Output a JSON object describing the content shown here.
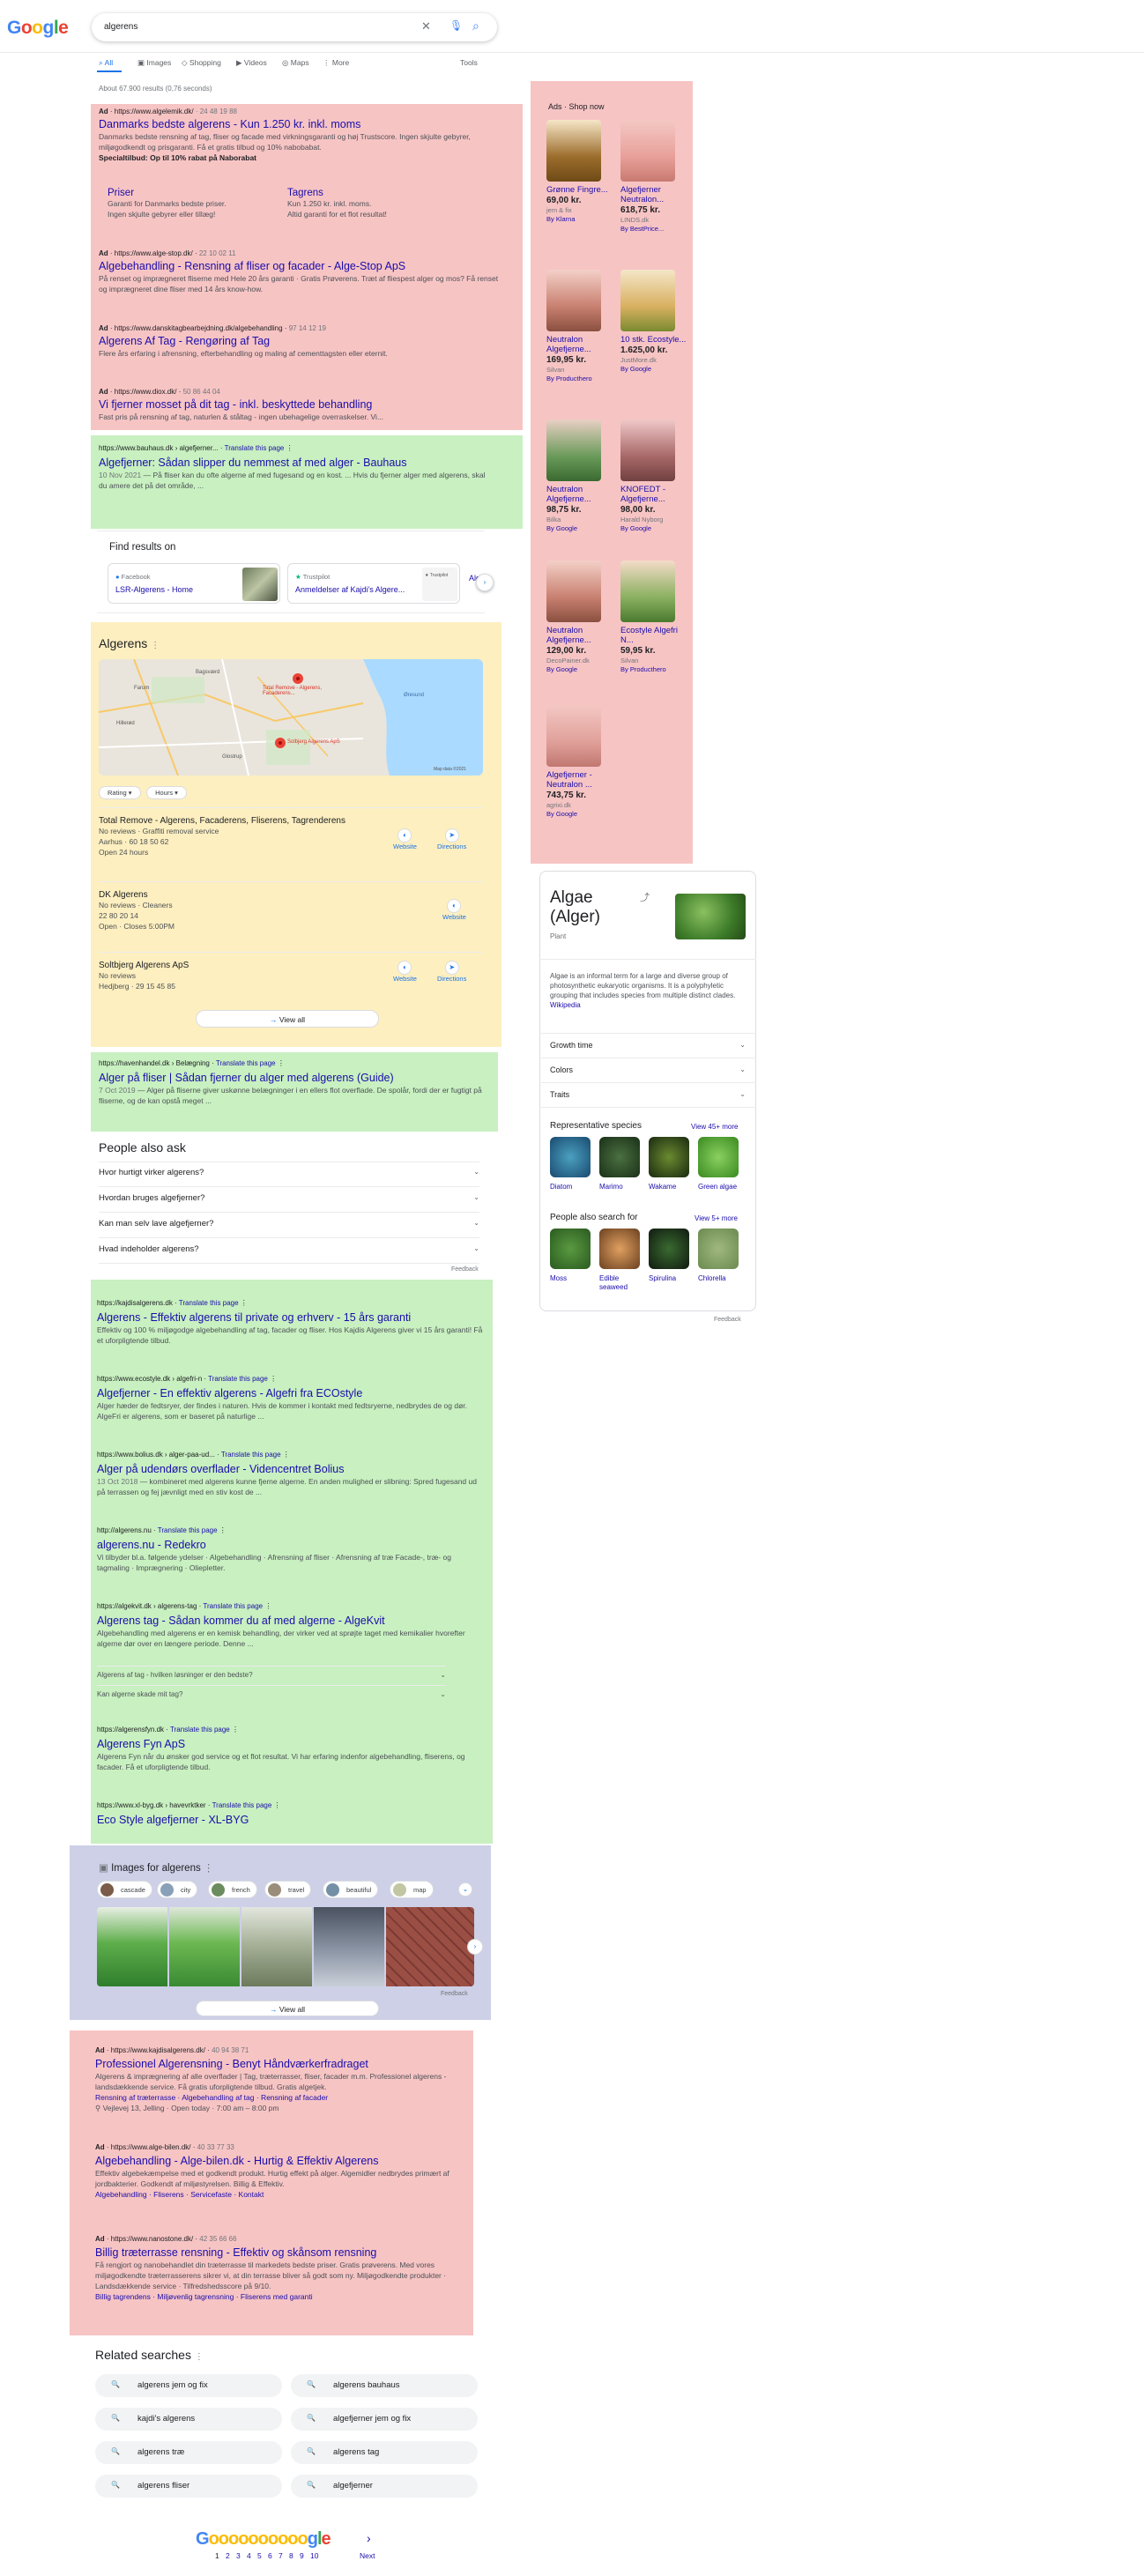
{
  "header": {
    "logo": "Google",
    "query": "algerens"
  },
  "tabs": [
    "All",
    "Images",
    "Shopping",
    "Videos",
    "Maps",
    "More"
  ],
  "tools": "Tools",
  "stats": "About 67.900 results (0,76 seconds)",
  "top_ads": [
    {
      "label": "Ad",
      "url": "https://www.algelemik.dk/",
      "phone": "24 48 19 88",
      "title": "Danmarks bedste algerens - Kun 1.250 kr. inkl. moms",
      "desc": "Danmarks bedste rensning af tag, fliser og facade med virkningsgaranti og høj Trustscore. Ingen skjulte gebyrer, miljøgodkendt og prisgaranti. Få et gratis tilbud og 10% nabobabat.",
      "special": "Specialtilbud: Op til 10% rabat på Naborabat",
      "sitelinks": [
        {
          "title": "Priser",
          "l1": "Garanti for Danmarks bedste priser.",
          "l2": "Ingen skjulte gebyrer eller tillæg!"
        },
        {
          "title": "Tagrens",
          "l1": "Kun 1.250 kr. inkl. moms.",
          "l2": "Altid garanti for et flot resultat!"
        }
      ]
    },
    {
      "label": "Ad",
      "url": "https://www.alge-stop.dk/",
      "phone": "22 10 02 11",
      "title": "Algebehandling - Rensning af fliser og facader - Alge-Stop ApS",
      "desc": "På renset og imprægneret fliserne med Hele 20 års garanti · Gratis Prøverens. Træt af fliespest alger og mos? Få renset og imprægneret dine fliser med 14 års know-how."
    },
    {
      "label": "Ad",
      "url": "https://www.danskitagbearbejdning.dk/algebehandling",
      "phone": "97 14 12 19",
      "title": "Algerens Af Tag - Rengøring af Tag",
      "desc": "Flere års erfaring i afrensning, efterbehandling og maling af cementtagsten eller eternit."
    },
    {
      "label": "Ad",
      "url": "https://www.diox.dk/",
      "phone": "50 86 44 04",
      "title": "Vi fjerner mosset på dit tag - inkl. beskyttede behandling",
      "desc": "Fast pris på rensning af tag, naturlen & ståltag - ingen ubehagelige overraskelser. Vi..."
    }
  ],
  "bauhaus": {
    "url": "https://www.bauhaus.dk › algefjerner...",
    "translate": "Translate this page",
    "title": "Algefjerner: Sådan slipper du nemmest af med alger - Bauhaus",
    "date": "10 Nov 2021",
    "desc": "— På fliser kan du ofte algerne af med fugesand og en kost. ... Hvis du fjerner alger med algerens, skal du amere det på det område, ..."
  },
  "find_results": {
    "title": "Find results on",
    "items": [
      {
        "site": "Facebook",
        "name": "LSR-Algerens - Home"
      },
      {
        "site": "Trustpilot",
        "name": "Anmeldelser af Kajdi's Algere..."
      }
    ],
    "more": "Alg"
  },
  "local": {
    "title": "Algerens",
    "map_credit": "Map data ©2021",
    "map_labels": [
      "Bagsværd",
      "Farum",
      "Hillerød",
      "Glostrup",
      "Solbjerg Algerens ApS",
      "Total Remove - Algerens, Facaderens...",
      "Øresund"
    ],
    "filters": [
      "Rating",
      "Hours"
    ],
    "businesses": [
      {
        "name": "Total Remove - Algerens, Facaderens, Fliserens, Tagrenderens",
        "reviews": "No reviews · Graffiti removal service",
        "addr": "Aarhus · 60 18 50 62",
        "hours": "Open 24 hours",
        "actions": [
          "Website",
          "Directions"
        ]
      },
      {
        "name": "DK Algerens",
        "reviews": "No reviews · Cleaners",
        "addr": "22 80 20 14",
        "hours": "Open · Closes 5:00PM",
        "actions": [
          "Website"
        ]
      },
      {
        "name": "Soltbjerg Algerens ApS",
        "reviews": "No reviews",
        "addr": "Hedjberg · 29 15 45 85",
        "hours": "",
        "actions": [
          "Website",
          "Directions"
        ]
      }
    ],
    "view_all": "View all"
  },
  "havenhandel": {
    "url": "https://havenhandel.dk › Belægning",
    "translate": "Translate this page",
    "title": "Alger på fliser | Sådan fjerner du alger med algerens (Guide)",
    "date": "7 Oct 2019",
    "desc": "— Alger på fliserne giver uskønne belægninger i en ellers flot overflade. De spolår, fordi der er fugtigt på fliserne, og de kan opstå meget ..."
  },
  "paa": {
    "title": "People also ask",
    "questions": [
      "Hvor hurtigt virker algerens?",
      "Hvordan bruges algefjerner?",
      "Kan man selv lave algefjerner?",
      "Hvad indeholder algerens?"
    ],
    "feedback": "Feedback"
  },
  "organic": [
    {
      "url": "https://kajdisalgerens.dk",
      "translate": "Translate this page",
      "title": "Algerens - Effektiv algerens til private og erhverv - 15 års garanti",
      "desc": "Effektiv og 100 % miljøgodge algebehandling af tag, facader og fliser. Hos Kajdis Algerens giver vi 15 års garanti! Få et uforpligtende tilbud."
    },
    {
      "url": "https://www.ecostyle.dk › algefri-n",
      "translate": "Translate this page",
      "title": "Algefjerner - En effektiv algerens - Algefri fra ECOstyle",
      "desc": "Alger hæder de fedtsryer, der findes i naturen. Hvis de kommer i kontakt med fedtsryerne, nedbrydes de og dør. AlgeFri er algerens, som er baseret på naturlige ..."
    },
    {
      "url": "https://www.bolius.dk › alger-paa-ud...",
      "translate": "Translate this page",
      "title": "Alger på udendørs overflader - Videncentret Bolius",
      "date": "13 Oct 2018",
      "desc": "— kombineret med algerens kunne fjerne algerne. En anden mulighed er slibning: Spred fugesand ud på terrassen og fej jævnligt med en stiv kost de ..."
    },
    {
      "url": "http://algerens.nu",
      "translate": "Translate this page",
      "title": "algerens.nu - Redekro",
      "desc": "Vi tilbyder bl.a. følgende ydelser · Algebehandling · Afrensning af fliser · Afrensning af træ Facade-, træ- og tagmaling · Imprægnering · Oliepletter."
    },
    {
      "url": "https://algekvit.dk › algerens-tag",
      "translate": "Translate this page",
      "title": "Algerens tag - Sådan kommer du af med algerne - AlgeKvit",
      "desc": "Algebehandling med algerens er en kemisk behandling, der virker ved at sprøjte taget med kemikalier hvorefter algerne dør over en længere periode. Denne ..."
    },
    {
      "url": "https://algerensfyn.dk",
      "translate": "Translate this page",
      "title": "Algerens Fyn ApS",
      "desc": "Algerens Fyn når du ønsker god service og et flot resultat. Vi har erfaring indenfor algebehandling, fliserens, og facader. Få et uforpligtende tilbud."
    },
    {
      "url": "https://www.xl-byg.dk › havevrktker",
      "translate": "Translate this page",
      "title": "Eco Style algefjerner - XL-BYG",
      "desc": ""
    }
  ],
  "algekvit_faq": [
    "Algerens af tag - hvilken løsninger er den bedste?",
    "Kan algerne skade mit tag?"
  ],
  "images": {
    "title": "Images for algerens",
    "chips": [
      "cascade",
      "city",
      "french",
      "travel",
      "beautiful",
      "map"
    ],
    "view_all": "View all",
    "feedback": "Feedback"
  },
  "bottom_ads": [
    {
      "label": "Ad",
      "url": "https://www.kajdisalgerens.dk/",
      "phone": "40 94 38 71",
      "title": "Professionel Algerensning - Benyt Håndværkerfradraget",
      "desc": "Algerens & imprægnering af alle overflader | Tag, træterrasser, fliser, facader m.m. Professionel algerens - landsdækkende service. Få gratis uforpligtende tilbud. Gratis algetjek.",
      "links": "Rensning af træterrasse · Algebehandling af tag · Rensning af facader",
      "location": "Vejlevej 13, Jelling · Open today · 7:00 am – 8:00 pm"
    },
    {
      "label": "Ad",
      "url": "https://www.alge-bilen.dk/",
      "phone": "40 33 77 33",
      "title": "Algebehandling - Alge-bilen.dk - Hurtig & Effektiv Algerens",
      "desc": "Effektiv algebekæmpelse med et godkendt produkt. Hurtig effekt på alger. Algemidler nedbrydes primært af jordbakterier. Godkendt af miljøstyrelsen. Billig & Effektiv.",
      "links": "Algebehandling · Fliserens · Servicefaste · Kontakt"
    },
    {
      "label": "Ad",
      "url": "https://www.nanostone.dk/",
      "phone": "42 35 66 66",
      "title": "Billig træterrasse rensning - Effektiv og skånsom rensning",
      "desc": "Få rengjort og nanobehandlet din træterrasse til markedets bedste priser. Gratis prøverens. Med vores miljøgodkendte træterrasserens sikrer vi, at din terrasse bliver så godt som ny. Miljøgodkendte produkter · Landsdækkende service · Tilfredshedsscore på 9/10.",
      "links": "Billig tagrendens · Miljøvenlig tagrensning · Fliserens med garanti"
    }
  ],
  "related": {
    "title": "Related searches",
    "items": [
      "algerens jem og fix",
      "algerens bauhaus",
      "kajdi's algerens",
      "algefjerner jem og fix",
      "algerens træ",
      "algerens tag",
      "algerens fliser",
      "algefjerner"
    ]
  },
  "pagination": {
    "logo": "Goooooooooogle",
    "pages": [
      "1",
      "2",
      "3",
      "4",
      "5",
      "6",
      "7",
      "8",
      "9",
      "10"
    ],
    "next": "Next"
  },
  "shop": {
    "header": "Ads · Shop now",
    "items": [
      {
        "name": "Grønne Fingre...",
        "price": "69,00 kr.",
        "seller": "jem & fix",
        "by": "By Klarna"
      },
      {
        "name": "Algefjerner Neutralon...",
        "price": "618,75 kr.",
        "seller": "LINDS.dk",
        "by": "By BestPrice..."
      },
      {
        "name": "Neutralon Algefjerne...",
        "price": "169,95 kr.",
        "seller": "Silvan",
        "by": "By Producthero"
      },
      {
        "name": "10 stk. Ecostyle...",
        "price": "1.625,00 kr.",
        "seller": "JustMore.dk",
        "by": "By Google"
      },
      {
        "name": "Neutralon Algefjerne...",
        "price": "98,75 kr.",
        "seller": "Bilka",
        "by": "By Google"
      },
      {
        "name": "KNOFEDT - Algefjerne...",
        "price": "98,00 kr.",
        "seller": "Harald Nyborg",
        "by": "By Google"
      },
      {
        "name": "Neutralon Algefjerne...",
        "price": "129,00 kr.",
        "seller": "DecoPainer.dk",
        "by": "By Google"
      },
      {
        "name": "Ecostyle Algefri N...",
        "price": "59,95 kr.",
        "seller": "Silvan",
        "by": "By Producthero"
      },
      {
        "name": "Algefjerner - Neutralon ...",
        "price": "743,75 kr.",
        "seller": "agrixi.dk",
        "by": "By Google"
      }
    ]
  },
  "knowledge": {
    "title": "Algae (Alger)",
    "subtitle": "Plant",
    "desc": "Algae is an informal term for a large and diverse group of photosynthetic eukaryotic organisms. It is a polyphyletic grouping that includes species from multiple distinct clades.",
    "wiki": "Wikipedia",
    "facets": [
      "Growth time",
      "Colors",
      "Traits"
    ],
    "rep_title": "Representative species",
    "rep_more": "View 45+ more",
    "rep": [
      "Diatom",
      "Marimo",
      "Wakame",
      "Green algae"
    ],
    "pasf_title": "People also search for",
    "pasf_more": "View 5+ more",
    "pasf": [
      "Moss",
      "Edible seaweed",
      "Spirulina",
      "Chlorella"
    ],
    "feedback": "Feedback"
  }
}
